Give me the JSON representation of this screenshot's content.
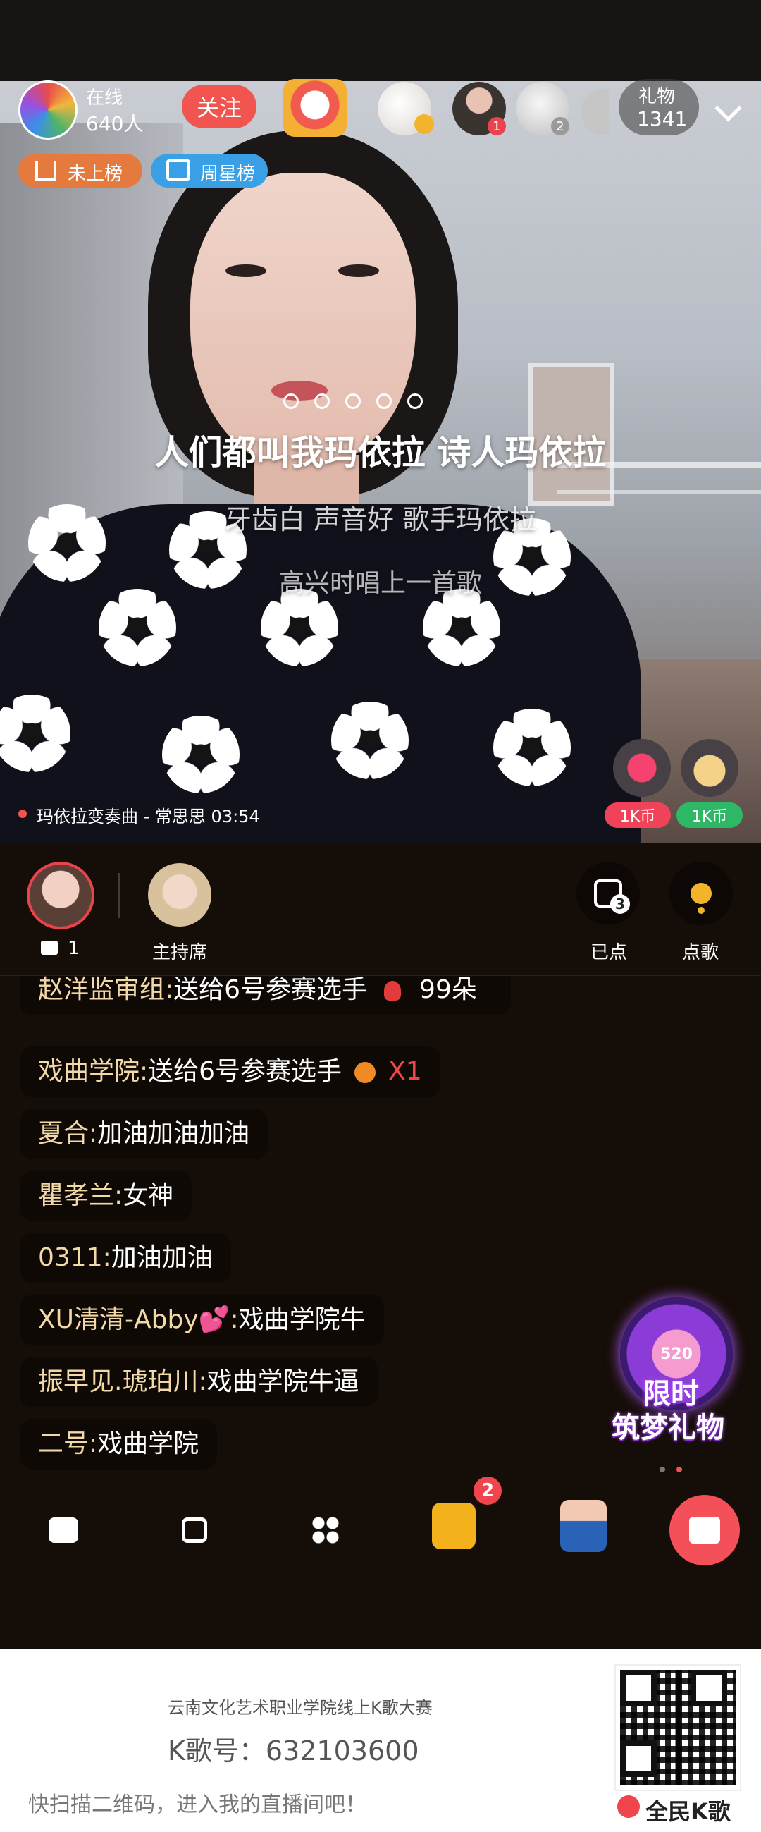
{
  "room": {
    "online_label": "在线",
    "online_count": "640人",
    "follow_label": "关注",
    "gift_label": "礼物",
    "gift_count": "1341",
    "badge_rank": "未上榜",
    "badge_week": "周星榜",
    "viewer_badge_1": "1",
    "viewer_badge_2": "2"
  },
  "lyrics": {
    "line1": "人们都叫我玛依拉 诗人玛依拉",
    "line2": "牙齿白 声音好 歌手玛依拉",
    "line3": "高兴时唱上一首歌"
  },
  "song": {
    "now_playing": "玛依拉变奏曲 - 常思思 03:54"
  },
  "tips": {
    "heart_coin": "1K币",
    "bag_coin": "1K币"
  },
  "seats": {
    "gift_count": "1",
    "host_label": "主持席",
    "played_label": "已点",
    "played_count": "3",
    "request_label": "点歌"
  },
  "chat": [
    {
      "name": "赵洋监审组:",
      "text": "送给6号参赛选手",
      "extra": "99朵"
    },
    {
      "name": "戏曲学院:",
      "text": "送给6号参赛选手",
      "extra": "X1"
    },
    {
      "name": "夏合:",
      "text": "加油加油加油",
      "extra": ""
    },
    {
      "name": "瞿孝兰:",
      "text": "女神",
      "extra": ""
    },
    {
      "name": "0311:",
      "text": "加油加油",
      "extra": ""
    },
    {
      "name": "XU清清-Abby💕:",
      "text": "戏曲学院牛",
      "extra": ""
    },
    {
      "name": "振早见.琥珀川:",
      "text": "戏曲学院牛逼",
      "extra": ""
    },
    {
      "name": "二号:",
      "text": "戏曲学院",
      "extra": ""
    }
  ],
  "promo": {
    "wheel_number": "520",
    "line1": "限时",
    "line2": "筑梦礼物"
  },
  "toolbar": {
    "task_badge": "2"
  },
  "footer": {
    "event": "云南文化艺术职业学院线上K歌大赛",
    "kid_label": "K歌号：632103600",
    "scan_hint": "快扫描二维码，进入我的直播间吧！",
    "brand": "全民K歌"
  },
  "colors": {
    "follow": "#f2554f",
    "badge_rank": "#e47a3e",
    "badge_week": "#3aa0e6",
    "coin_red": "#f0435a",
    "coin_green": "#2cb865",
    "gift_button": "#f4505a",
    "task_yellow": "#f3b21c"
  }
}
